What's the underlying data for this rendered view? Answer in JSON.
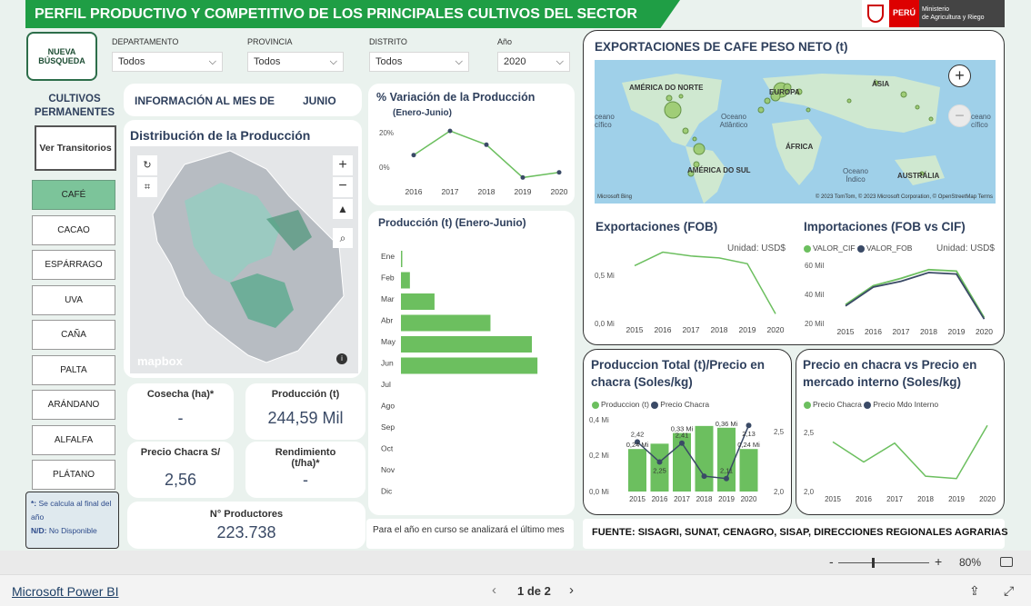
{
  "header": {
    "title": "PERFIL PRODUCTIVO Y COMPETITIVO DE LOS PRINCIPALES CULTIVOS DEL SECTOR",
    "country": "PERÚ",
    "ministry_line1": "Ministerio",
    "ministry_line2": "de Agricultura y Riego",
    "colors": {
      "bar": "#1f9e45",
      "accent": "#7cc49a"
    }
  },
  "filters": {
    "new_search": "NUEVA BÚSQUEDA",
    "departamento": {
      "label": "DEPARTAMENTO",
      "value": "Todos"
    },
    "provincia": {
      "label": "PROVINCIA",
      "value": "Todos"
    },
    "distrito": {
      "label": "DISTRITO",
      "value": "Todos"
    },
    "anio": {
      "label": "Año",
      "value": "2020"
    }
  },
  "sidebar": {
    "heading": "CULTIVOS PERMANENTES",
    "toggle": "Ver Transitorios",
    "crops": [
      "CAFÉ",
      "CACAO",
      "ESPÁRRAGO",
      "UVA",
      "CAÑA",
      "PALTA",
      "ARÁNDANO",
      "ALFALFA",
      "PLÁTANO"
    ],
    "selected": "CAFÉ",
    "note_star": "*:",
    "note_star_text": " Se calcula al final del año",
    "note_nd": "N/D:",
    "note_nd_text": " No Disponible"
  },
  "info": {
    "label": "INFORMACIÓN AL MES DE",
    "month": "JUNIO"
  },
  "map_peru": {
    "title": "Distribución de la Producción",
    "brand": "mapbox"
  },
  "kpis": {
    "cosecha": {
      "label": "Cosecha (ha)*",
      "value": "-"
    },
    "produccion": {
      "label": "Producción (t)",
      "value": "244,59 Mil"
    },
    "precio": {
      "label": "Precio Chacra S/",
      "value": "2,56"
    },
    "rendimiento": {
      "label": "Rendimiento (t/ha)*",
      "value": "-"
    },
    "productores": {
      "label": "N° Productores",
      "value": "223.738"
    }
  },
  "variation": {
    "title": "% Variación de la Producción",
    "subtitle": "(Enero-Junio)"
  },
  "production_bars": {
    "title": "Producción (t) (Enero-Junio)"
  },
  "footer_note": "Para el año en curso se analizará el último mes",
  "world": {
    "title": "EXPORTACIONES DE CAFE PESO NETO (t)",
    "labels": [
      "AMÉRICA DO NORTE",
      "EUROPA",
      "ÁSIA",
      "Oceano Atlântico",
      "ÁFRICA",
      "AMÉRICA DO SUL",
      "Oceano Índico",
      "AUSTRÁLIA",
      "ceano cífico",
      "ceano cífico"
    ],
    "attribution": "© 2023 TomTom, © 2023 Microsoft Corporation, © OpenStreetMap Terms",
    "bing": "Microsoft Bing"
  },
  "exports": {
    "title": "Exportaciones (FOB)",
    "unit": "Unidad: USD$"
  },
  "imports": {
    "title": "Importaciones (FOB vs CIF)",
    "unit": "Unidad: USD$",
    "legend": [
      "VALOR_CIF",
      "VALOR_FOB"
    ]
  },
  "prod_price": {
    "title": "Produccion Total (t)/Precio en chacra (Soles/kg)",
    "legend": [
      "Produccion (t)",
      "Precio Chacra"
    ]
  },
  "price_market": {
    "title": "Precio en chacra vs Precio en mercado interno (Soles/kg)",
    "legend": [
      "Precio Chacra",
      "Precio Mdo Interno"
    ]
  },
  "source": "FUENTE: SISAGRI, SUNAT, CENAGRO, SISAP, DIRECCIONES REGIONALES AGRARIAS",
  "statusbar": {
    "brand": "Microsoft Power BI",
    "page": "1 de 2",
    "zoom": "80%"
  },
  "chart_data": [
    {
      "type": "line",
      "title": "% Variación de la Producción",
      "x": [
        "2016",
        "2017",
        "2018",
        "2019",
        "2020"
      ],
      "values": [
        7,
        21,
        13,
        -6,
        -3
      ],
      "yticks": [
        "20%",
        "0%"
      ]
    },
    {
      "type": "bar",
      "title": "Producción (t) (Enero-Junio)",
      "categories": [
        "Ene",
        "Feb",
        "Mar",
        "Abr",
        "May",
        "Jun",
        "Jul",
        "Ago",
        "Sep",
        "Oct",
        "Nov",
        "Dic"
      ],
      "values": [
        1,
        8,
        30,
        80,
        117,
        122,
        0,
        0,
        0,
        0,
        0,
        0
      ]
    },
    {
      "type": "line",
      "title": "Exportaciones (FOB)",
      "x": [
        "2015",
        "2016",
        "2017",
        "2018",
        "2019",
        "2020"
      ],
      "values": [
        0.6,
        0.74,
        0.7,
        0.68,
        0.62,
        0.1
      ],
      "yticks": [
        "0,5 Mi",
        "0,0 Mi"
      ]
    },
    {
      "type": "line",
      "title": "Importaciones (FOB vs CIF)",
      "x": [
        "2015",
        "2016",
        "2017",
        "2018",
        "2019",
        "2020"
      ],
      "series": [
        {
          "name": "VALOR_CIF",
          "values": [
            33,
            46,
            51,
            57,
            56,
            24
          ]
        },
        {
          "name": "VALOR_FOB",
          "values": [
            32,
            45,
            49,
            55,
            54,
            23
          ]
        }
      ],
      "yticks": [
        "60 Mil",
        "40 Mil",
        "20 Mil"
      ]
    },
    {
      "type": "bar",
      "title": "Produccion Total (t)/Precio en chacra (Soles/kg)",
      "x": [
        "2015",
        "2016",
        "2017",
        "2018",
        "2019",
        "2020"
      ],
      "series": [
        {
          "name": "Produccion (t)",
          "values": [
            0.24,
            0.27,
            0.33,
            0.37,
            0.36,
            0.24
          ]
        },
        {
          "name": "Precio Chacra",
          "values": [
            2.42,
            2.25,
            2.41,
            2.13,
            2.11,
            2.56
          ]
        }
      ],
      "bar_labels": [
        "0,24 Mi",
        "",
        "0,33 Mi",
        "",
        "0,36 Mi",
        "0,24 Mi"
      ],
      "price_labels": [
        "2,42",
        "2,25",
        "2,41",
        "",
        "2,11",
        "2,13"
      ],
      "yticks_left": [
        "0,4 Mi",
        "0,2 Mi",
        "0,0 Mi"
      ],
      "yticks_right": [
        "2,5",
        "2,0"
      ]
    },
    {
      "type": "line",
      "title": "Precio en chacra vs Precio en mercado interno (Soles/kg)",
      "x": [
        "2015",
        "2016",
        "2017",
        "2018",
        "2019",
        "2020"
      ],
      "series": [
        {
          "name": "Precio Chacra",
          "values": [
            2.42,
            2.25,
            2.41,
            2.13,
            2.11,
            2.56
          ]
        }
      ],
      "yticks": [
        "2,5",
        "2,0"
      ]
    }
  ]
}
